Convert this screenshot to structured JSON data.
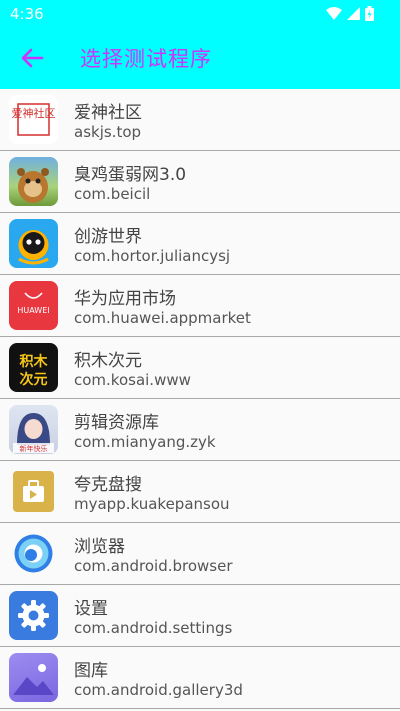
{
  "status": {
    "time": "4:36"
  },
  "header": {
    "title": "选择测试程序"
  },
  "apps": [
    {
      "name": "爱神社区",
      "package": "askjs.top",
      "icon": "aishen-icon",
      "icon_text": "爱神社区"
    },
    {
      "name": "臭鸡蛋弱网3.0",
      "package": "com.beicil",
      "icon": "bear-cartoon-icon"
    },
    {
      "name": "创游世界",
      "package": "com.hortor.juliancysj",
      "icon": "chuangyou-icon"
    },
    {
      "name": "华为应用市场",
      "package": "com.huawei.appmarket",
      "icon": "huawei-appgallery-icon",
      "icon_text": "HUAWEI"
    },
    {
      "name": "积木次元",
      "package": "com.kosai.www",
      "icon": "jimu-icon",
      "icon_text": "积木次元"
    },
    {
      "name": "剪辑资源库",
      "package": "com.mianyang.zyk",
      "icon": "anime-girl-icon",
      "icon_text": "新年快乐"
    },
    {
      "name": "夸克盘搜",
      "package": "myapp.kuakepansou",
      "icon": "kuake-icon"
    },
    {
      "name": "浏览器",
      "package": "com.android.browser",
      "icon": "browser-icon"
    },
    {
      "name": "设置",
      "package": "com.android.settings",
      "icon": "settings-gear-icon"
    },
    {
      "name": "图库",
      "package": "com.android.gallery3d",
      "icon": "gallery-icon"
    }
  ],
  "colors": {
    "appbar": "#00ffff",
    "title": "#cc33ff"
  }
}
